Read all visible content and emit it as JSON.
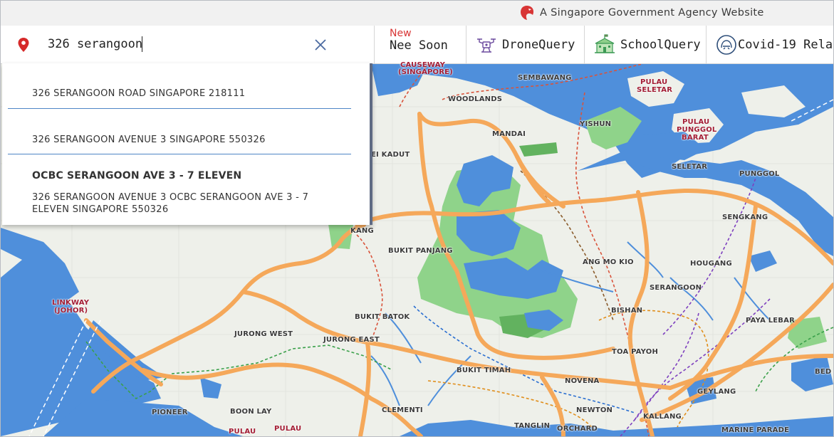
{
  "agency": {
    "text": "A Singapore Government Agency Website"
  },
  "search": {
    "value": "326 serangoon"
  },
  "tabs": [
    {
      "badge": "New",
      "label": "Nee Soon",
      "icon": "none"
    },
    {
      "label": "DroneQuery",
      "icon": "drone-icon"
    },
    {
      "label": "SchoolQuery",
      "icon": "school-icon"
    },
    {
      "label": "Covid-19 Relat",
      "icon": "covid-icon"
    }
  ],
  "suggestions": [
    {
      "address": "326 SERANGOON ROAD SINGAPORE 218111"
    },
    {
      "address": "326 SERANGOON AVENUE 3 SINGAPORE 550326"
    },
    {
      "building": "OCBC SERANGOON AVE 3 - 7 ELEVEN",
      "address": "326 SERANGOON AVENUE 3 OCBC SERANGOON AVE 3 - 7 ELEVEN SINGAPORE 550326"
    }
  ],
  "map_labels": {
    "causeway": "CAUSEWAY",
    "singapore": "(SINGAPORE)",
    "sembawang": "SEMBAWANG",
    "woodlands": "WOODLANDS",
    "pulau_seletar_1": "PULAU",
    "pulau_seletar_2": "SELETAR",
    "mandai": "MANDAI",
    "yishun": "YISHUN",
    "pulau_punggol_1": "PULAU",
    "pulau_punggol_2": "PUNGGOL",
    "pulau_punggol_3": "BARAT",
    "kadut": "EI KADUT",
    "seletar": "SELETAR",
    "punggol": "PUNGGOL",
    "sengkang": "SENGKANG",
    "kang": "KANG",
    "bukit_panjang": "BUKIT PANJANG",
    "ang_mo_kio": "ANG MO KIO",
    "hougang": "HOUGANG",
    "serangoon": "SERANGOON",
    "linkway_1": "LINKWAY",
    "linkway_2": "(JOHOR)",
    "bukit_batok": "BUKIT BATOK",
    "bishan": "BISHAN",
    "paya_lebar": "PAYA LEBAR",
    "jurong_west": "JURONG WEST",
    "jurong_east": "JURONG EAST",
    "toa_payoh": "TOA PAYOH",
    "bukit_timah": "BUKIT TIMAH",
    "novena": "NOVENA",
    "bed": "BED",
    "geylang": "GEYLANG",
    "pioneer": "PIONEER",
    "boon_lay": "BOON LAY",
    "clementi": "CLEMENTI",
    "newton": "NEWTON",
    "kallang": "KALLANG",
    "tanglin": "TANGLIN",
    "orchard": "ORCHARD",
    "pulau_a": "PULAU",
    "pulau_b": "PULAU",
    "marine_parade": "MARINE PARADE"
  },
  "colors": {
    "water": "#4f8fdb",
    "expressway": "#f5a85a",
    "park": "#8fd38a",
    "brand_red": "#d83535"
  }
}
